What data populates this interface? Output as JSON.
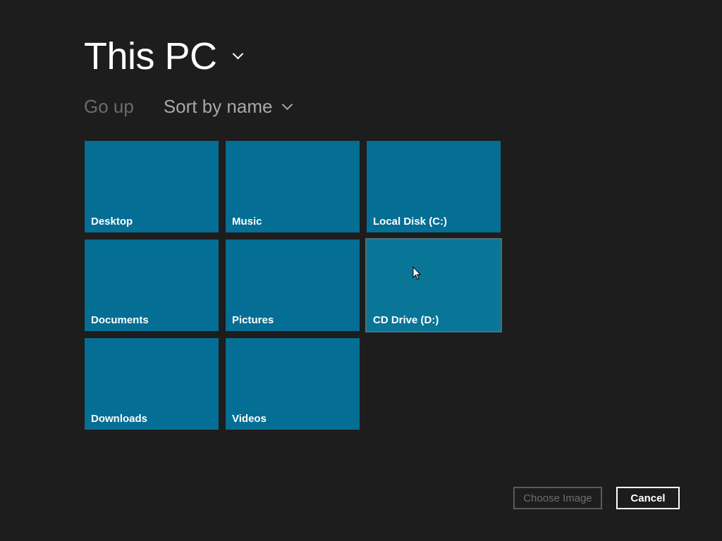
{
  "header": {
    "title": "This PC",
    "title_icon": "chevron-down-icon"
  },
  "toolbar": {
    "go_up_label": "Go up",
    "sort_label": "Sort by name",
    "sort_icon": "chevron-down-icon"
  },
  "tiles": [
    {
      "label": "Desktop"
    },
    {
      "label": "Music"
    },
    {
      "label": "Local Disk (C:)"
    },
    {
      "label": "Documents"
    },
    {
      "label": "Pictures"
    },
    {
      "label": "CD Drive (D:)",
      "hovered": true
    },
    {
      "label": "Downloads"
    },
    {
      "label": "Videos"
    }
  ],
  "footer": {
    "choose_label": "Choose Image",
    "choose_enabled": false,
    "cancel_label": "Cancel"
  },
  "colors": {
    "background": "#1d1d1d",
    "tile": "#056e94",
    "text": "#ffffff",
    "disabled_text": "#6e6e6e"
  }
}
